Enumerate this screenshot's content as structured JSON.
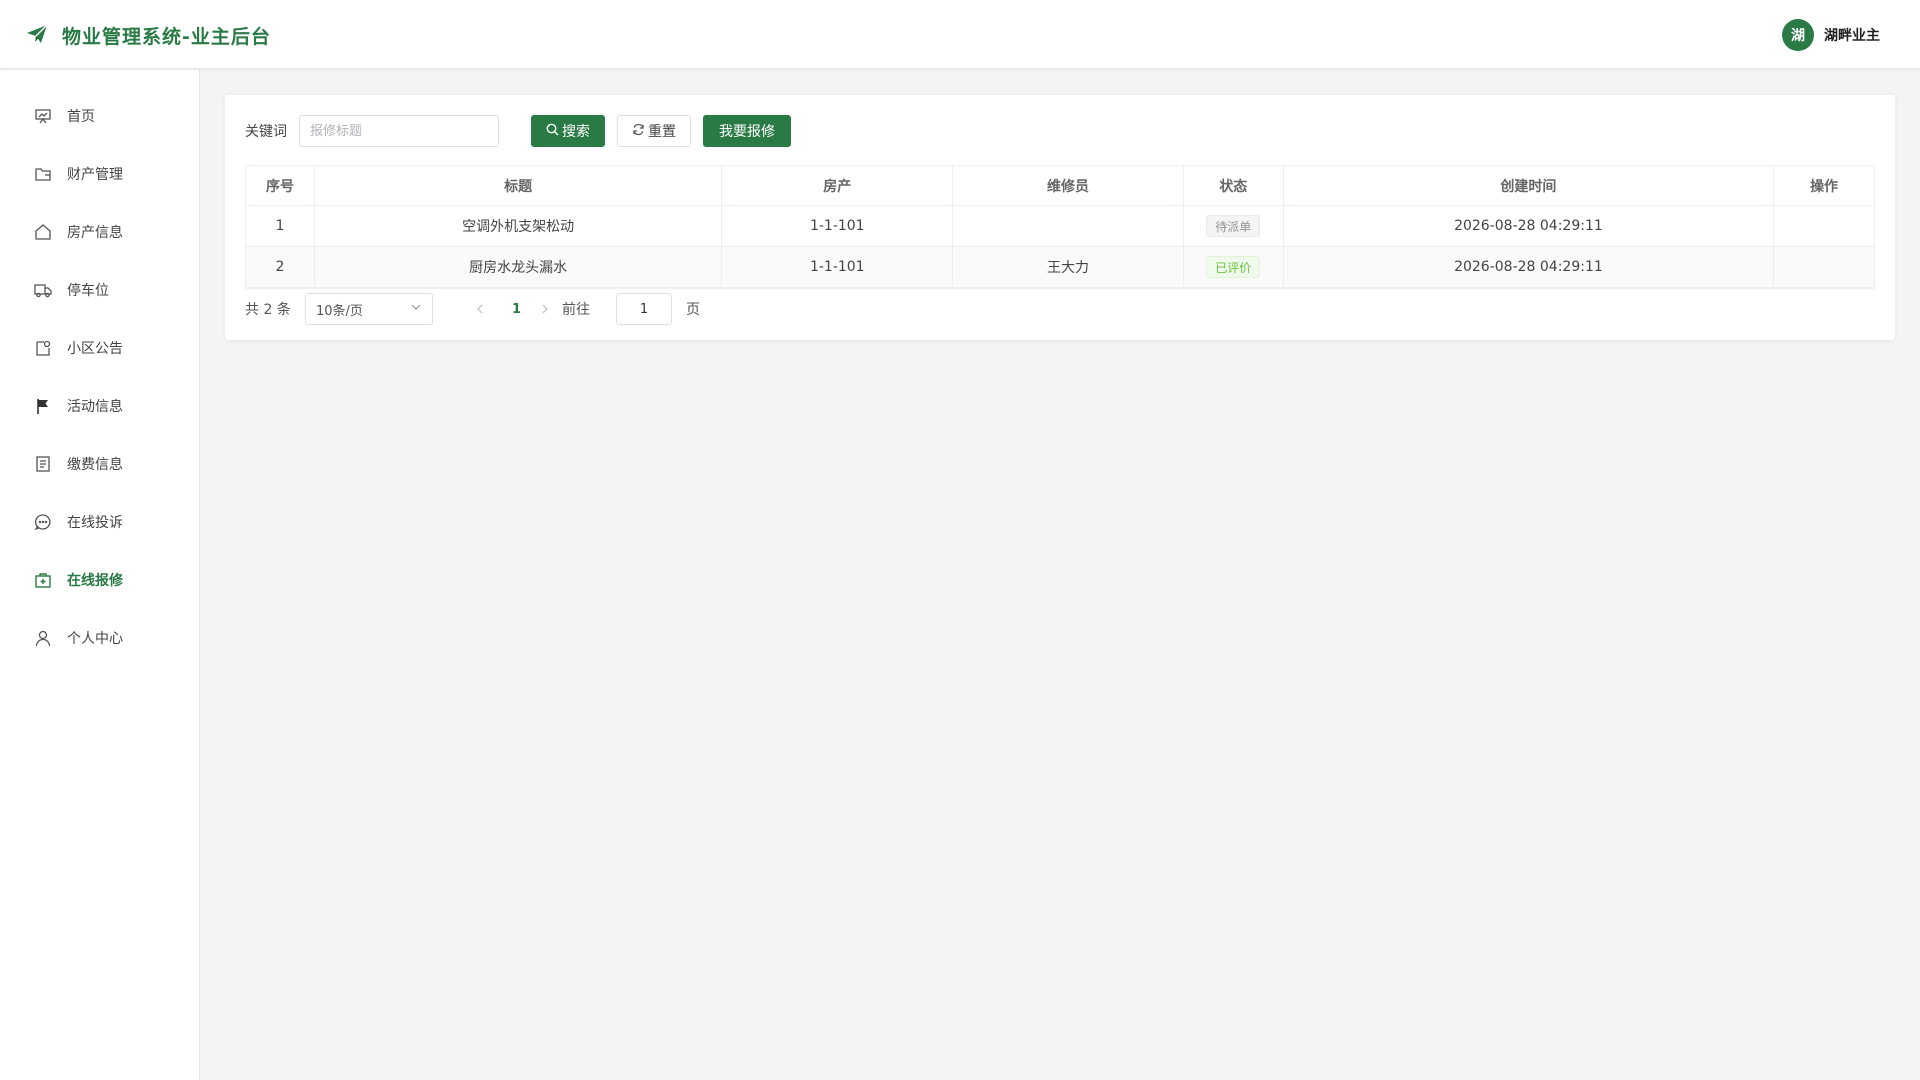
{
  "app": {
    "title": "物业管理系统-业主后台",
    "accent": "#2a7a45"
  },
  "user": {
    "avatar_text": "湖",
    "name": "湖畔业主"
  },
  "sidebar": {
    "items": [
      {
        "label": "首页",
        "icon": "dashboard-icon"
      },
      {
        "label": "财产管理",
        "icon": "folder-icon"
      },
      {
        "label": "房产信息",
        "icon": "house-icon"
      },
      {
        "label": "停车位",
        "icon": "truck-icon"
      },
      {
        "label": "小区公告",
        "icon": "notice-icon"
      },
      {
        "label": "活动信息",
        "icon": "flag-icon"
      },
      {
        "label": "缴费信息",
        "icon": "document-icon"
      },
      {
        "label": "在线投诉",
        "icon": "chat-icon"
      },
      {
        "label": "在线报修",
        "icon": "first-aid-icon",
        "active": true
      },
      {
        "label": "个人中心",
        "icon": "user-icon"
      }
    ]
  },
  "search": {
    "label": "关键词",
    "placeholder": "报修标题",
    "value": "",
    "search_button": "搜索",
    "reset_button": "重置",
    "add_button": "我要报修"
  },
  "table": {
    "columns": [
      "序号",
      "标题",
      "房产",
      "维修员",
      "状态",
      "创建时间",
      "操作"
    ],
    "rows": [
      {
        "index": "1",
        "title": "空调外机支架松动",
        "property": "1-1-101",
        "repairer": "",
        "status": "待派单",
        "created": "2026-08-28 04:29:11",
        "action": ""
      },
      {
        "index": "2",
        "title": "厨房水龙头漏水",
        "property": "1-1-101",
        "repairer": "王大力",
        "status": "已评价",
        "created": "2026-08-28 04:29:11",
        "action": ""
      }
    ]
  },
  "pagination": {
    "total": "共 2 条",
    "page_size": "10条/页",
    "current_page": "1",
    "goto_label": "前往",
    "goto_value": "1",
    "page_suffix": "页"
  }
}
